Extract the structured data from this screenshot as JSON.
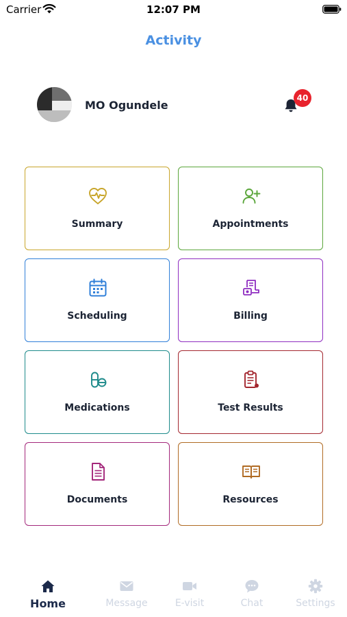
{
  "status_bar": {
    "carrier": "Carrier",
    "time": "12:07 PM",
    "icons": [
      "wifi-icon",
      "battery-icon"
    ]
  },
  "header": {
    "title": "Activity",
    "title_color": "#4a90e2"
  },
  "profile": {
    "name": "MO Ogundele",
    "notification_count": "40",
    "badge_color": "#e8232d"
  },
  "tiles": [
    {
      "label": "Summary",
      "icon": "heart-pulse-icon",
      "color": "#c8a52a"
    },
    {
      "label": "Appointments",
      "icon": "user-plus-icon",
      "color": "#5aa63a"
    },
    {
      "label": "Scheduling",
      "icon": "calendar-icon",
      "color": "#2f7fd8"
    },
    {
      "label": "Billing",
      "icon": "receipt-money-icon",
      "color": "#8e2cc0"
    },
    {
      "label": "Medications",
      "icon": "pills-icon",
      "color": "#1d8a8a"
    },
    {
      "label": "Test Results",
      "icon": "clipboard-results-icon",
      "color": "#a3262e"
    },
    {
      "label": "Documents",
      "icon": "document-icon",
      "color": "#a3267a"
    },
    {
      "label": "Resources",
      "icon": "open-book-icon",
      "color": "#b06a22"
    }
  ],
  "tab_bar": {
    "active_color": "#1c2a4a",
    "inactive_color": "#cfd6e2",
    "tabs": [
      {
        "label": "Home",
        "icon": "home-icon",
        "active": true
      },
      {
        "label": "Message",
        "icon": "envelope-icon",
        "active": false
      },
      {
        "label": "E-visit",
        "icon": "video-camera-icon",
        "active": false
      },
      {
        "label": "Chat",
        "icon": "chat-bubble-icon",
        "active": false
      },
      {
        "label": "Settings",
        "icon": "gear-icon",
        "active": false
      }
    ]
  }
}
